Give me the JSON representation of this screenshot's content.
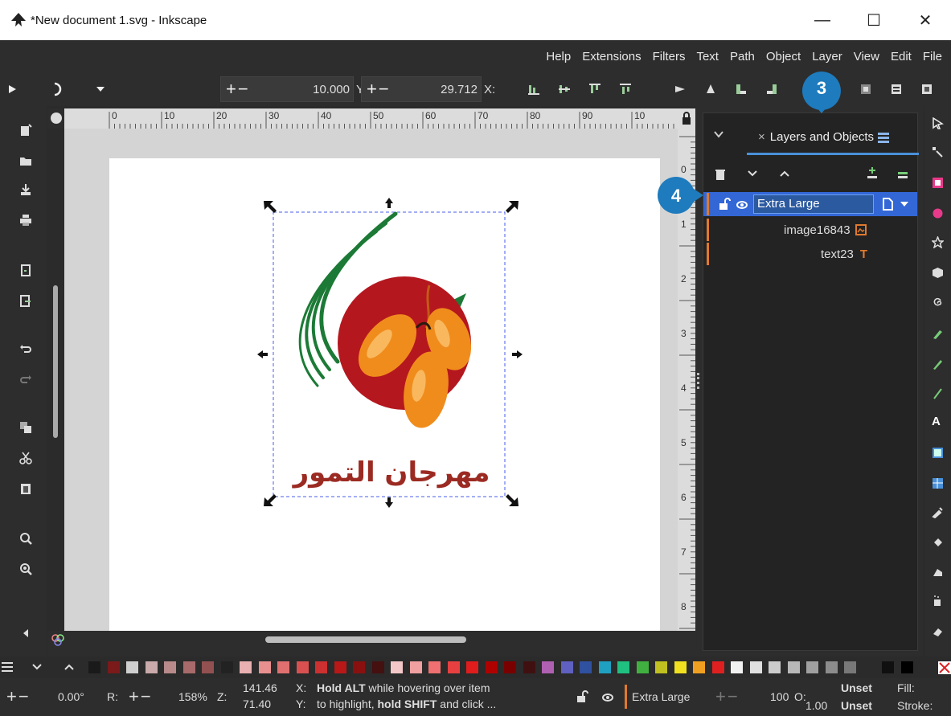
{
  "window": {
    "title": "*New document 1.svg - Inkscape",
    "controls": {
      "minimize": "—",
      "maximize": "☐",
      "close": "✕"
    }
  },
  "menu": [
    "File",
    "Edit",
    "View",
    "Layer",
    "Object",
    "Path",
    "Text",
    "Filters",
    "Extensions",
    "Help"
  ],
  "tool_controls": {
    "x_label": "X:",
    "x_value": "29.712",
    "y_label": "Y:",
    "y_value": "10.000",
    "plus_minus": "+−"
  },
  "ruler": {
    "top_labels": [
      "0",
      "10",
      "20",
      "30",
      "40",
      "50",
      "60",
      "70",
      "80",
      "90",
      "10"
    ],
    "right_labels": [
      "0",
      "1",
      "2",
      "3",
      "4",
      "5",
      "6",
      "7",
      "8"
    ]
  },
  "artwork": {
    "arabic_title": "مهرجان التمور",
    "colors": {
      "red": "#b5171e",
      "orange": "#f08c1c",
      "green": "#1c7a36",
      "text": "#9b2b22"
    }
  },
  "layers_panel": {
    "tab_label": "Layers and Objects",
    "close_x": "×",
    "rows": [
      {
        "name": "Extra Large",
        "type": "layer",
        "selected": true
      },
      {
        "name": "image16843",
        "type": "image"
      },
      {
        "name": "text23",
        "type": "text",
        "type_glyph": "T"
      }
    ]
  },
  "callouts": {
    "three": "3",
    "four": "4"
  },
  "palette": {
    "swatches": [
      "#1a1a1a",
      "#7a1a1a",
      "#cfcfcf",
      "#c9a9a9",
      "#b88a8a",
      "#a86a6a",
      "#935050",
      "#222222",
      "#e8b0b0",
      "#e89090",
      "#e07070",
      "#d85050",
      "#cc3030",
      "#b81818",
      "#8a1010",
      "#441010",
      "#f4c8c8",
      "#f0a0a0",
      "#ee7070",
      "#e84040",
      "#e01c1c",
      "#b00000",
      "#7a0000",
      "#401010",
      "#b060b0",
      "#6060c0",
      "#3050a0",
      "#20a0c0",
      "#20c080",
      "#40b040",
      "#c0c020",
      "#f0e020",
      "#f0a020",
      "#e02020",
      "#f2f2f2",
      "#e0e0e0",
      "#cccccc",
      "#b8b8b8",
      "#a0a0a0",
      "#8c8c8c",
      "#787878",
      "#2b2b2b",
      "#101010",
      "#000000"
    ]
  },
  "status": {
    "rotation": "0.00°",
    "r_label": "R:",
    "zoom": "158%",
    "z_label": "Z:",
    "cursor_x": "141.46",
    "cursor_y": "71.40",
    "x_label": "X:",
    "y_label": "Y:",
    "hint_line1_bold": "Hold ALT",
    "hint_line1": "while hovering over item",
    "hint_line2_pre": "to highlight,",
    "hint_line2_bold": "hold SHIFT",
    "hint_line2_post": "and click ...",
    "layer_name": "Extra Large",
    "opacity": "100",
    "o_label": "O:",
    "fill_label": "Fill:",
    "stroke_label": "Stroke:",
    "fill_value": "Unset",
    "stroke_value": "Unset",
    "stroke_width": "1.00"
  }
}
